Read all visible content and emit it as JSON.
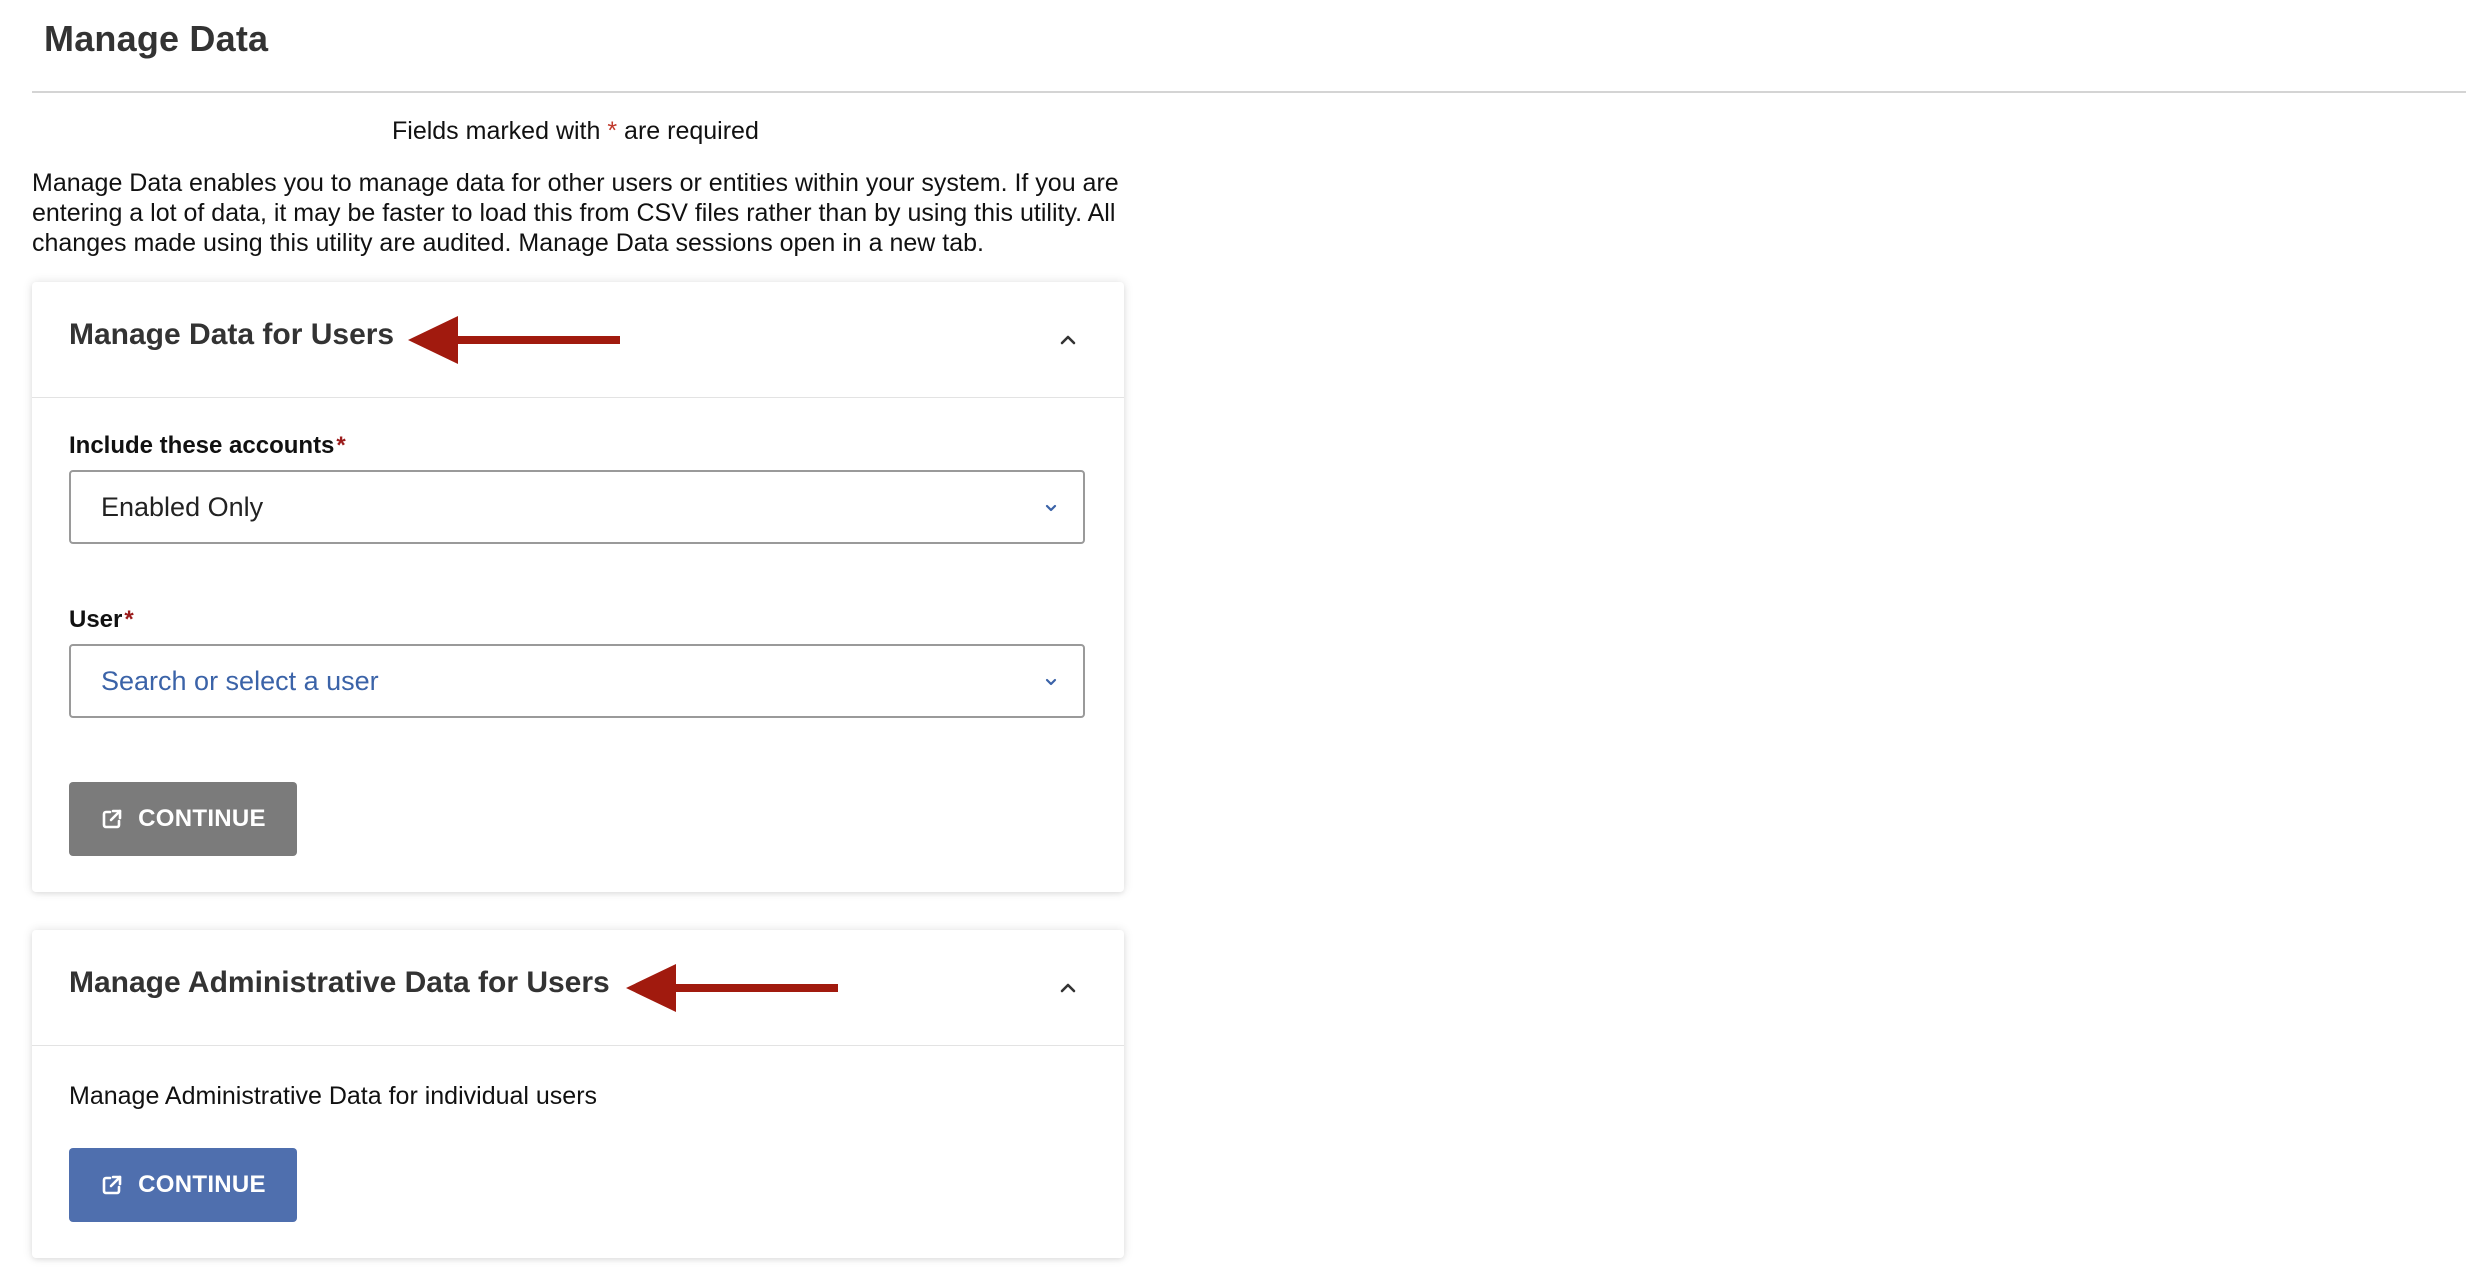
{
  "page": {
    "title": "Manage Data",
    "required_note_prefix": "Fields marked with ",
    "required_star": "*",
    "required_note_suffix": " are required",
    "intro": "Manage Data enables you to manage data for other users or entities within your system. If you are entering a lot of data, it may be faster to load this from CSV files rather than by using this utility. All changes made using this utility are audited. Manage Data sessions open in a new tab."
  },
  "manage_users": {
    "title": "Manage Data for Users",
    "accounts_label": "Include these accounts",
    "accounts_value": "Enabled Only",
    "user_label": "User",
    "user_placeholder": "Search or select a user",
    "required_star": "*",
    "continue_label": "CONTINUE",
    "continue_state": "disabled"
  },
  "manage_admin": {
    "title": "Manage Administrative Data for Users",
    "description": "Manage Administrative Data for individual users",
    "continue_label": "CONTINUE"
  },
  "icons": {
    "collapse": "chevron-up-icon",
    "select": "chevron-down-icon",
    "continue": "external-link-icon",
    "annotation": "red-arrow-annotation"
  },
  "colors": {
    "annotation_arrow": "#a11a0e",
    "required_star": "#c0392b",
    "primary_button": "#4f6fae",
    "disabled_button": "#7b7b7b",
    "placeholder_text": "#3b63a8"
  }
}
